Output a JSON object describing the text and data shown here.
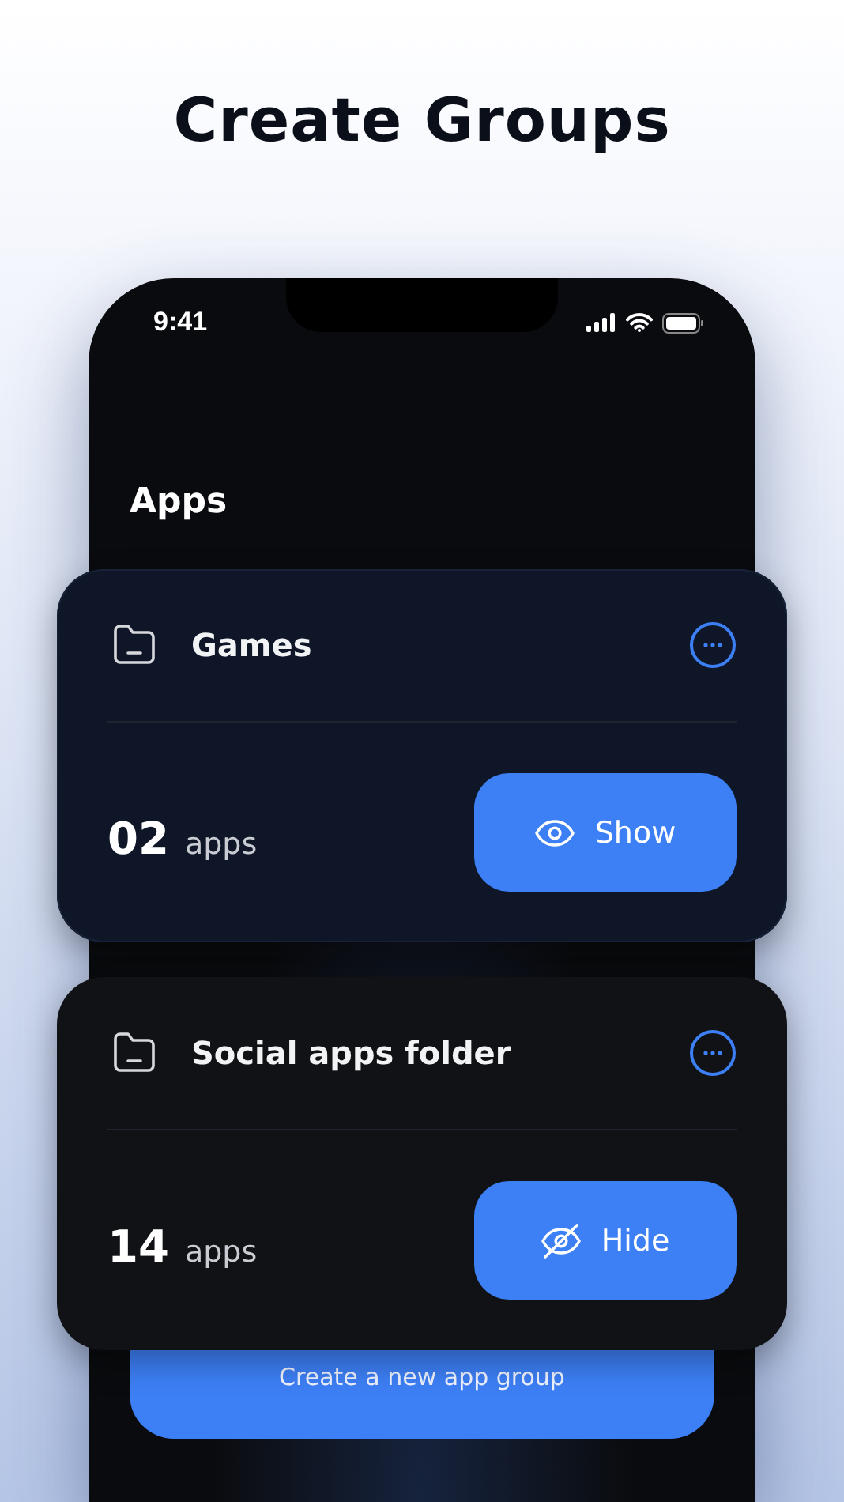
{
  "headline": "Create Groups",
  "status_bar": {
    "time": "9:41"
  },
  "screen_title": "Apps",
  "groups": [
    {
      "name": "Games",
      "count": "02",
      "unit": "apps",
      "selected": true,
      "button": {
        "kind": "show",
        "label": "Show"
      }
    },
    {
      "name": "Social apps folder",
      "count": "14",
      "unit": "apps",
      "selected": false,
      "button": {
        "kind": "hide",
        "label": "Hide"
      }
    }
  ],
  "create_button": "Create a new app group"
}
